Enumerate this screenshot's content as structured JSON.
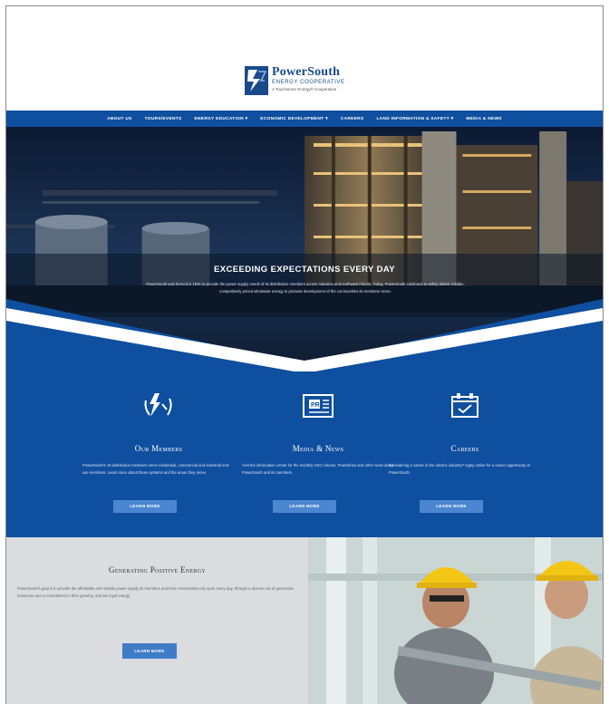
{
  "header": {
    "logo_name": "PowerSouth",
    "logo_sub": "ENERGY COOPERATIVE",
    "logo_tag": "A Touchstone Energy® Cooperative"
  },
  "nav": {
    "items": [
      "ABOUT US",
      "TOURS/EVENTS",
      "ENERGY EDUCATION ▾",
      "ECONOMIC DEVELOPMENT ▾",
      "CAREERS",
      "LAND INFORMATION & SAFETY ▾",
      "MEDIA & NEWS"
    ]
  },
  "hero": {
    "title": "EXCEEDING EXPECTATIONS EVERY DAY",
    "text": "PowerSouth was formed in 1941 to provide the power supply needs of its distribution members across Alabama and northwest Florida. Today, PowerSouth continues to safely deliver reliable, competitively priced wholesale energy to promote development of the communities its members serve."
  },
  "features": [
    {
      "icon": "lightning-hands-icon",
      "title": "Our Members",
      "text": "PowerSouth's 16 distribution members serve residential, commercial and industrial end-use members. Learn more about these systems and the areas they serve.",
      "button": "LEARN MORE"
    },
    {
      "icon": "newspaper-icon",
      "title": "Media & News",
      "text": "Visit the information center for the monthly CEO column, Powerlines and other news about PowerSouth and its members.",
      "button": "LEARN MORE"
    },
    {
      "icon": "briefcase-icon",
      "title": "Careers",
      "text": "Considering a career in the electric industry? Apply online for a career opportunity at PowerSouth.",
      "button": "LEARN MORE"
    }
  ],
  "generating": {
    "title": "Generating Positive Energy",
    "text": "PowerSouth's goal is to provide the affordable and reliable power supply its members and their communities rely upon every day, through a diverse mix of generation resources and a commitment to their growing, and are loyal energy.",
    "button": "LEARN MORE"
  },
  "colors": {
    "brand_blue": "#0f4f9f",
    "button_blue": "#4b86d0",
    "gray_panel": "#dadcdf"
  }
}
